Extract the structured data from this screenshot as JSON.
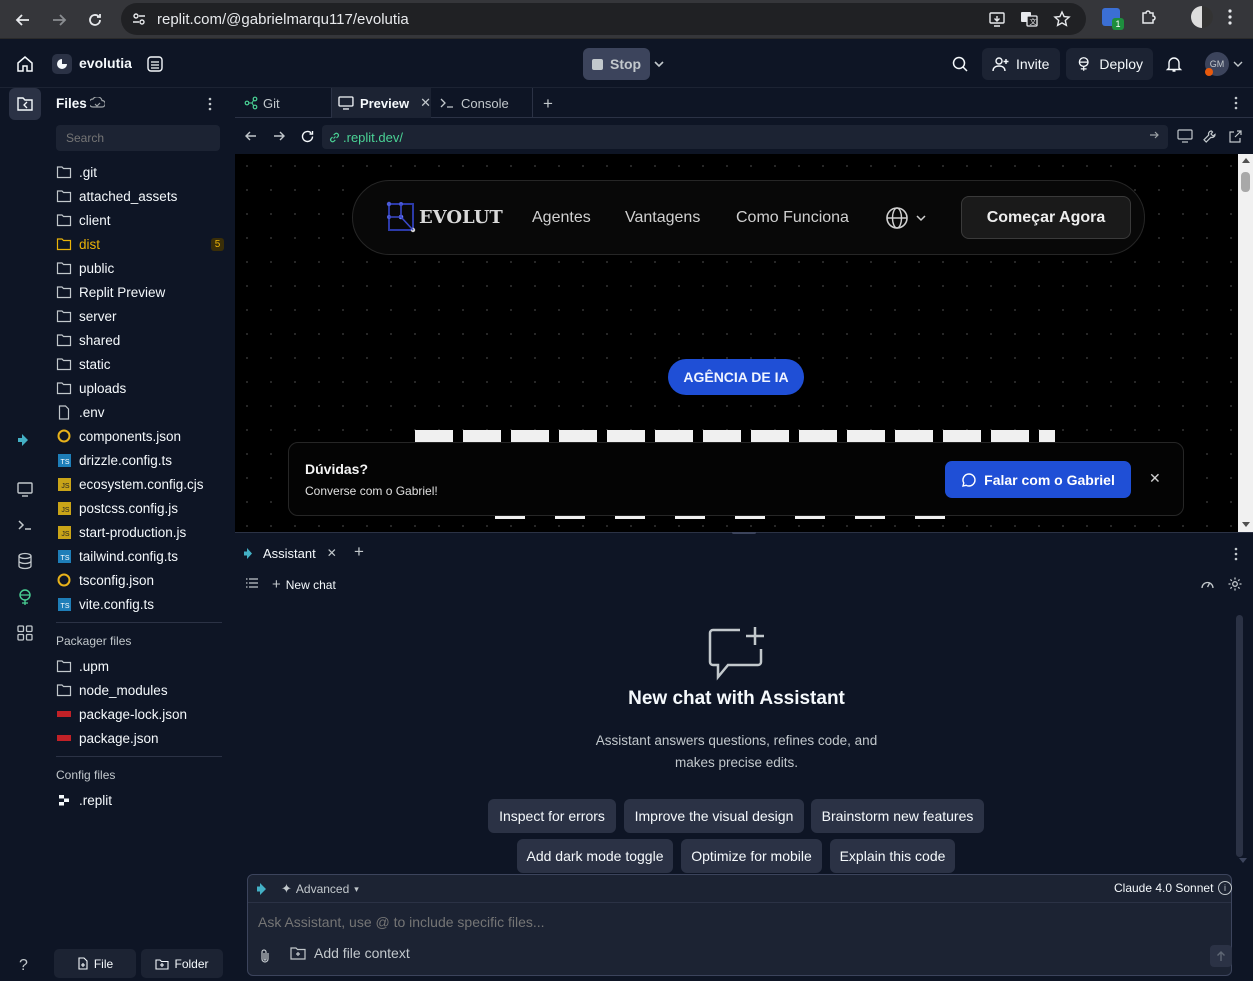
{
  "browser": {
    "url": "replit.com/@gabrielmarqu117/evolutia",
    "extension_badge": "1"
  },
  "header": {
    "project_name": "evolutia",
    "stop_label": "Stop",
    "invite_label": "Invite",
    "deploy_label": "Deploy",
    "avatar_initials": "GM"
  },
  "files": {
    "title": "Files",
    "search_placeholder": "Search",
    "items": [
      {
        "name": ".git",
        "type": "folder"
      },
      {
        "name": "attached_assets",
        "type": "folder"
      },
      {
        "name": "client",
        "type": "folder"
      },
      {
        "name": "dist",
        "type": "folder",
        "badge": "5",
        "color": "#eab308"
      },
      {
        "name": "public",
        "type": "folder"
      },
      {
        "name": "Replit Preview",
        "type": "folder"
      },
      {
        "name": "server",
        "type": "folder"
      },
      {
        "name": "shared",
        "type": "folder"
      },
      {
        "name": "static",
        "type": "folder"
      },
      {
        "name": "uploads",
        "type": "folder"
      },
      {
        "name": ".env",
        "type": "file"
      },
      {
        "name": "components.json",
        "type": "json"
      },
      {
        "name": "drizzle.config.ts",
        "type": "ts"
      },
      {
        "name": "ecosystem.config.cjs",
        "type": "js"
      },
      {
        "name": "postcss.config.js",
        "type": "js"
      },
      {
        "name": "start-production.js",
        "type": "js"
      },
      {
        "name": "tailwind.config.ts",
        "type": "ts"
      },
      {
        "name": "tsconfig.json",
        "type": "json"
      },
      {
        "name": "vite.config.ts",
        "type": "ts"
      }
    ],
    "packager_title": "Packager files",
    "packager_items": [
      {
        "name": ".upm",
        "type": "folder"
      },
      {
        "name": "node_modules",
        "type": "folder"
      },
      {
        "name": "package-lock.json",
        "type": "npm"
      },
      {
        "name": "package.json",
        "type": "npm"
      }
    ],
    "config_title": "Config files",
    "config_items": [
      {
        "name": ".replit",
        "type": "replit"
      }
    ],
    "new_file_label": "File",
    "new_folder_label": "Folder"
  },
  "tabs": [
    {
      "label": "Git"
    },
    {
      "label": "Preview"
    },
    {
      "label": "Console"
    }
  ],
  "preview": {
    "url": ".replit.dev/",
    "site": {
      "logo_text": "EVOLUT",
      "nav": [
        "Agentes",
        "Vantagens",
        "Como Funciona"
      ],
      "cta": "Começar Agora",
      "badge": "AGÊNCIA DE IA",
      "chat_title": "Dúvidas?",
      "chat_subtitle": "Converse com o Gabriel!",
      "chat_button": "Falar com o Gabriel"
    }
  },
  "assistant": {
    "tab_label": "Assistant",
    "new_chat_label": "New chat",
    "heading": "New chat with Assistant",
    "description_line1": "Assistant answers questions, refines code, and",
    "description_line2": "makes precise edits.",
    "suggestions_row1": [
      "Inspect for errors",
      "Improve the visual design",
      "Brainstorm new features"
    ],
    "suggestions_row2": [
      "Add dark mode toggle",
      "Optimize for mobile",
      "Explain this code"
    ],
    "mode_label": "Advanced",
    "model_label": "Claude 4.0 Sonnet",
    "input_placeholder": "Ask Assistant, use @ to include specific files...",
    "add_context_label": "Add file context"
  },
  "colors": {
    "accent_blue": "#1f5fe0",
    "bg": "#0e1525",
    "surface": "#1c2333",
    "folder_yellow": "#eab308"
  }
}
